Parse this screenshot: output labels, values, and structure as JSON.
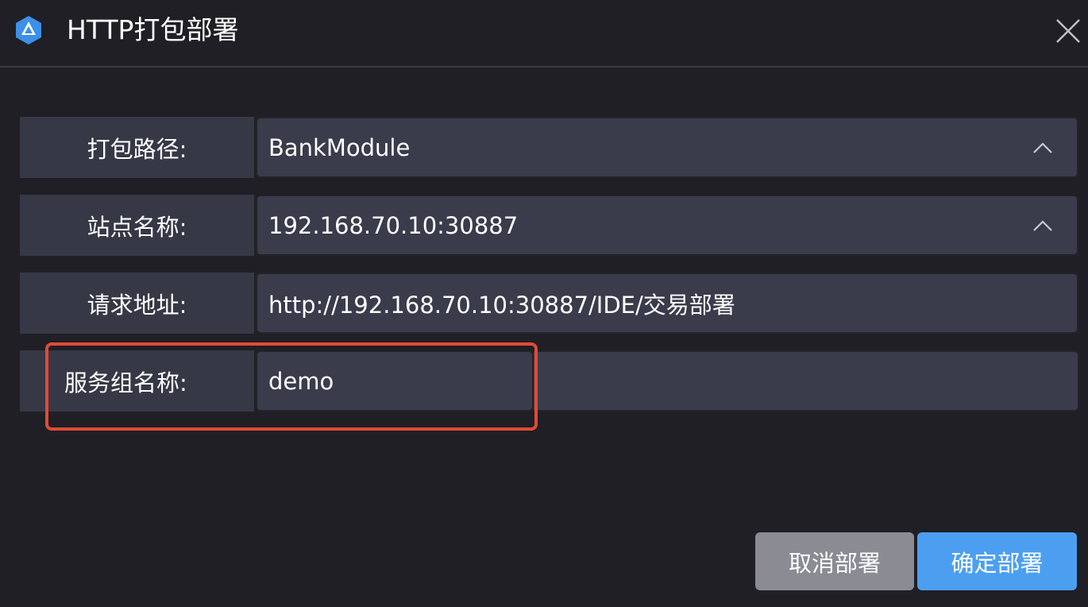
{
  "dialog": {
    "title": "HTTP打包部署",
    "accent_color": "#4c9ff0",
    "icons": {
      "app": "app-logo-icon",
      "close": "close-icon",
      "dropdown": "chevron-up-icon"
    }
  },
  "form": {
    "package_path": {
      "label": "打包路径:",
      "value": "BankModule"
    },
    "site_name": {
      "label": "站点名称:",
      "value": "192.168.70.10:30887"
    },
    "request_url": {
      "label": "请求地址:",
      "value": "http://192.168.70.10:30887/IDE/交易部署"
    },
    "service_group": {
      "label": "服务组名称:",
      "value": "demo"
    }
  },
  "buttons": {
    "cancel": "取消部署",
    "confirm": "确定部署"
  }
}
